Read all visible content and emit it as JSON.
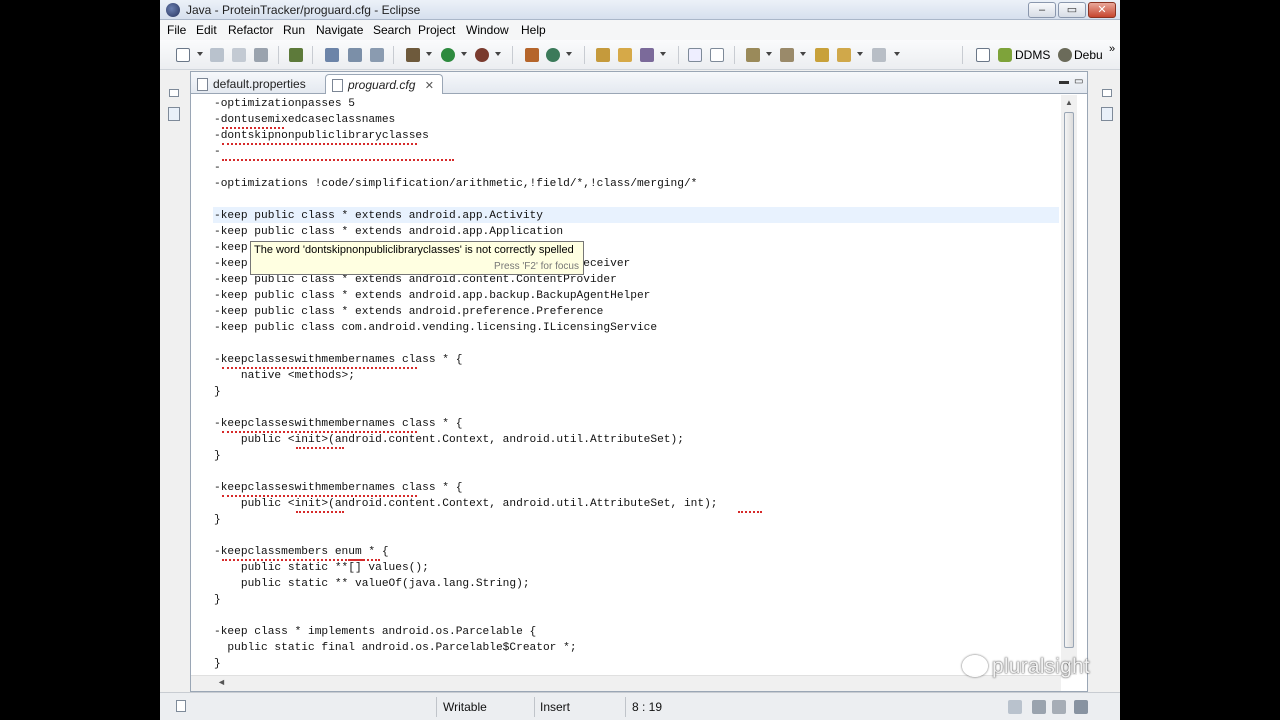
{
  "window": {
    "title": "Java - ProteinTracker/proguard.cfg - Eclipse",
    "controls": {
      "minimize": "–",
      "maximize": "▭",
      "close": "✕"
    }
  },
  "menubar": {
    "items": [
      "File",
      "Edit",
      "Refactor",
      "Run",
      "Navigate",
      "Search",
      "Project",
      "Window",
      "Help"
    ]
  },
  "toolbar": {
    "perspectives": {
      "ddms": "DDMS",
      "debug": "Debu",
      "overflow": "»"
    }
  },
  "editor": {
    "tabs": [
      {
        "label": "default.properties",
        "active": false
      },
      {
        "label": "proguard.cfg",
        "active": true,
        "close": "✕"
      }
    ],
    "lines": [
      "-optimizationpasses 5",
      "-dontusemixedcaseclassnames",
      "-dontskipnonpubliclibraryclasses",
      "-",
      "-",
      "-optimizations !code/simplification/arithmetic,!field/*,!class/merging/*",
      "",
      "-keep public class * extends android.app.Activity",
      "-keep public class * extends android.app.Application",
      "-keep public class * extends android.app.Service",
      "-keep public class * extends android.content.BroadcastReceiver",
      "-keep public class * extends android.content.ContentProvider",
      "-keep public class * extends android.app.backup.BackupAgentHelper",
      "-keep public class * extends android.preference.Preference",
      "-keep public class com.android.vending.licensing.ILicensingService",
      "",
      "-keepclasseswithmembernames class * {",
      "    native <methods>;",
      "}",
      "",
      "-keepclasseswithmembernames class * {",
      "    public <init>(android.content.Context, android.util.AttributeSet);",
      "}",
      "",
      "-keepclasseswithmembernames class * {",
      "    public <init>(android.content.Context, android.util.AttributeSet, int);",
      "}",
      "",
      "-keepclassmembers enum * {",
      "    public static **[] values();",
      "    public static ** valueOf(java.lang.String);",
      "}",
      "",
      "-keep class * implements android.os.Parcelable {",
      "  public static final android.os.Parcelable$Creator *;",
      "}"
    ],
    "tooltip": {
      "message": "The word 'dontskipnonpubliclibraryclasses' is not correctly spelled",
      "hint": "Press 'F2' for focus"
    }
  },
  "statusbar": {
    "mode": "Writable",
    "insert": "Insert",
    "position": "8 : 19"
  },
  "watermark": {
    "text": "pluralsight"
  }
}
